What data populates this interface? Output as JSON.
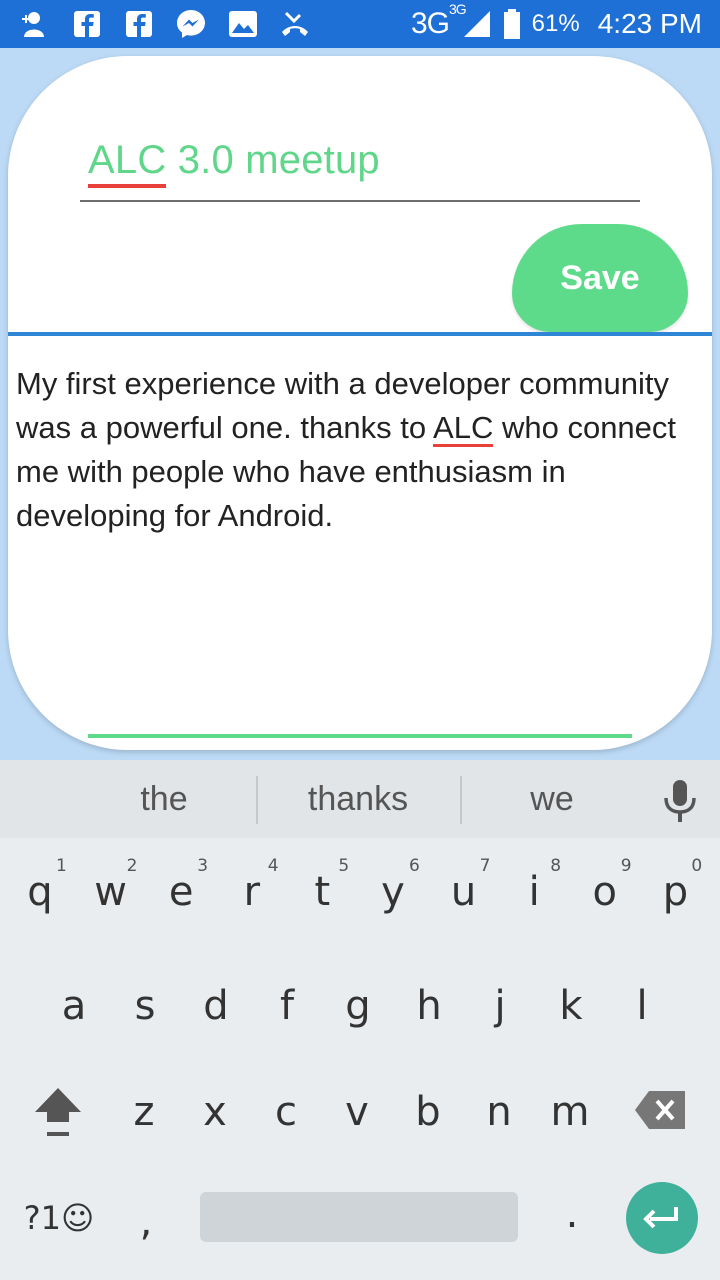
{
  "status_bar": {
    "network": "3G",
    "network_sup": "3G",
    "battery": "61%",
    "time": "4:23 PM",
    "icons": [
      "add-contact-icon",
      "facebook-icon",
      "facebook-icon",
      "messenger-icon",
      "image-icon",
      "missed-call-icon",
      "signal-icon",
      "battery-icon"
    ]
  },
  "note": {
    "title_misspelled": "ALC",
    "title_rest": " 3.0 meetup",
    "save_label": "Save",
    "body_part1": "My first experience with a developer community was a powerful one. thanks to ",
    "body_misspelled": "ALC",
    "body_part2": " who connect me with people who have enthusiasm in developing for Android."
  },
  "keyboard": {
    "suggestions": [
      "the",
      "thanks",
      "we"
    ],
    "row1": [
      "q",
      "w",
      "e",
      "r",
      "t",
      "y",
      "u",
      "i",
      "o",
      "p"
    ],
    "row1_hints": [
      "1",
      "2",
      "3",
      "4",
      "5",
      "6",
      "7",
      "8",
      "9",
      "0"
    ],
    "row2": [
      "a",
      "s",
      "d",
      "f",
      "g",
      "h",
      "j",
      "k",
      "l"
    ],
    "row3": [
      "z",
      "x",
      "c",
      "v",
      "b",
      "n",
      "m"
    ],
    "symbols_label": "?1☺",
    "comma": ",",
    "period": "."
  },
  "colors": {
    "status_bar": "#1e6fd6",
    "accent_green": "#5edb8a",
    "divider_blue": "#2f86d6",
    "enter_teal": "#3fb09a",
    "spell_red": "#e8413b"
  }
}
